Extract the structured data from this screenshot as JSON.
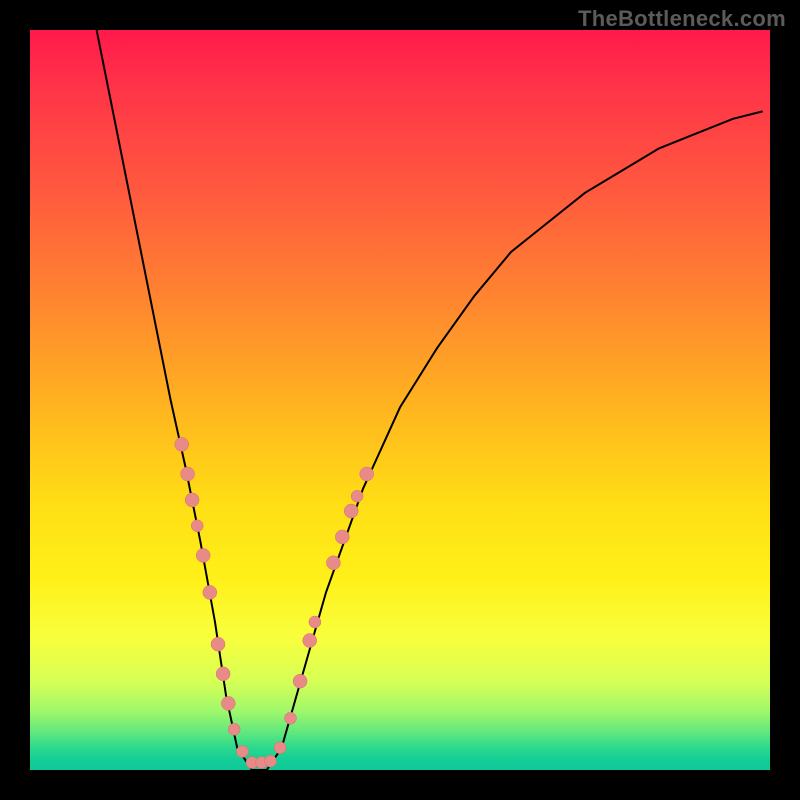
{
  "attribution": "TheBottleneck.com",
  "chart_data": {
    "type": "line",
    "title": "",
    "xlabel": "",
    "ylabel": "",
    "xlim": [
      0,
      100
    ],
    "ylim": [
      0,
      100
    ],
    "series": [
      {
        "name": "curve",
        "x": [
          9,
          11,
          13,
          15,
          17,
          19,
          21,
          23,
          25,
          26.5,
          28,
          30,
          32,
          34,
          36,
          40,
          45,
          50,
          55,
          60,
          65,
          70,
          75,
          80,
          85,
          90,
          95,
          99
        ],
        "y": [
          100,
          90,
          80,
          70,
          60,
          50,
          41,
          31,
          20,
          10,
          3,
          0,
          0,
          3,
          10,
          24,
          38,
          49,
          57,
          64,
          70,
          74,
          78,
          81,
          84,
          86,
          88,
          89
        ]
      }
    ],
    "markers": [
      {
        "x": 20.5,
        "y": 44,
        "r": 7
      },
      {
        "x": 21.3,
        "y": 40,
        "r": 7
      },
      {
        "x": 21.9,
        "y": 36.5,
        "r": 7
      },
      {
        "x": 22.6,
        "y": 33,
        "r": 6
      },
      {
        "x": 23.4,
        "y": 29,
        "r": 7
      },
      {
        "x": 24.3,
        "y": 24,
        "r": 7
      },
      {
        "x": 25.4,
        "y": 17,
        "r": 7
      },
      {
        "x": 26.1,
        "y": 13,
        "r": 7
      },
      {
        "x": 26.8,
        "y": 9,
        "r": 7
      },
      {
        "x": 27.6,
        "y": 5.5,
        "r": 6
      },
      {
        "x": 28.7,
        "y": 2.5,
        "r": 6
      },
      {
        "x": 30.0,
        "y": 1.0,
        "r": 6
      },
      {
        "x": 31.3,
        "y": 1.0,
        "r": 6
      },
      {
        "x": 32.5,
        "y": 1.2,
        "r": 6
      },
      {
        "x": 33.8,
        "y": 3.0,
        "r": 6
      },
      {
        "x": 35.2,
        "y": 7.0,
        "r": 6
      },
      {
        "x": 36.5,
        "y": 12.0,
        "r": 7
      },
      {
        "x": 37.8,
        "y": 17.5,
        "r": 7
      },
      {
        "x": 38.5,
        "y": 20.0,
        "r": 6
      },
      {
        "x": 41.0,
        "y": 28.0,
        "r": 7
      },
      {
        "x": 42.2,
        "y": 31.5,
        "r": 7
      },
      {
        "x": 43.4,
        "y": 35.0,
        "r": 7
      },
      {
        "x": 44.2,
        "y": 37.0,
        "r": 6
      },
      {
        "x": 45.5,
        "y": 40.0,
        "r": 7
      }
    ],
    "gradient_stops": [
      {
        "pct": 0,
        "color": "#ff1a4b"
      },
      {
        "pct": 50,
        "color": "#ffcf1a"
      },
      {
        "pct": 90,
        "color": "#e4ff4a"
      },
      {
        "pct": 100,
        "color": "#12c998"
      }
    ]
  }
}
